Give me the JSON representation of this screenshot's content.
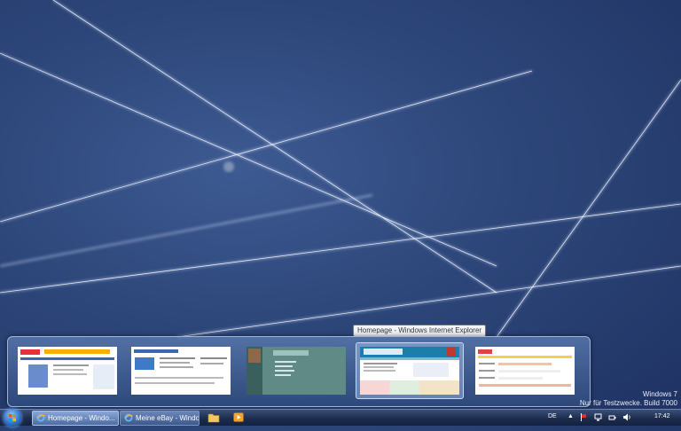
{
  "tooltip": "Homepage - Windows Internet Explorer",
  "watermark": {
    "line1": "Windows 7",
    "line2": "Nur für Testzwecke. Build 7000"
  },
  "taskbar": {
    "buttons": [
      {
        "label": "Homepage - Windo...",
        "active": true
      },
      {
        "label": "Meine eBay - Windo...",
        "active": false
      }
    ],
    "pinned": [
      "folder-icon",
      "media-player-icon"
    ],
    "tray": {
      "language": "DE",
      "clock": "17:42"
    }
  },
  "thumbnails": [
    {
      "name": "ebay-page",
      "active": false
    },
    {
      "name": "meine-ebay-page",
      "active": false
    },
    {
      "name": "green-site-page",
      "active": false
    },
    {
      "name": "homepage-page",
      "active": true
    },
    {
      "name": "form-page",
      "active": false
    }
  ],
  "colors": {
    "desktop": "#2d4679",
    "taskbar": "#1c2c4d",
    "accent": "#8fc6ff"
  }
}
